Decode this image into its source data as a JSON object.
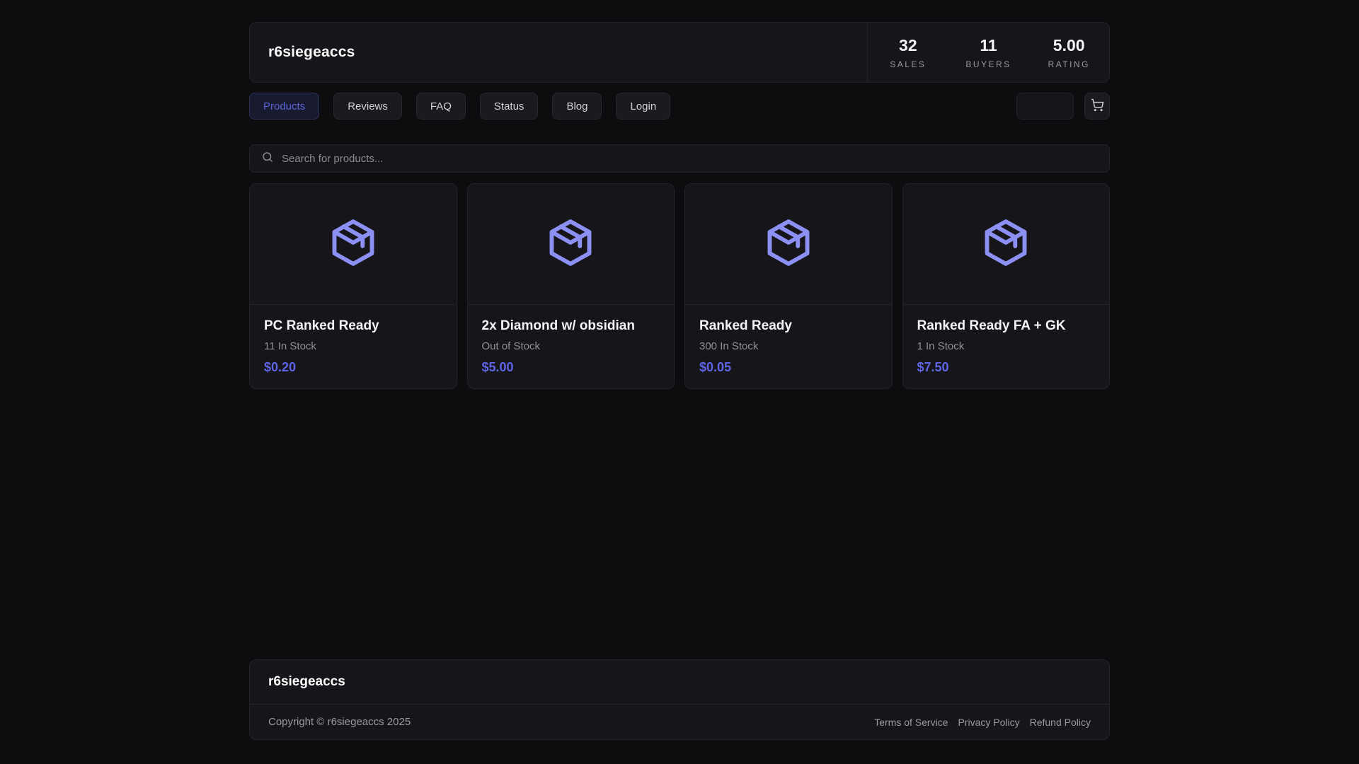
{
  "header": {
    "title": "r6siegeaccs",
    "stats": [
      {
        "value": "32",
        "label": "SALES"
      },
      {
        "value": "11",
        "label": "BUYERS"
      },
      {
        "value": "5.00",
        "label": "RATING"
      }
    ]
  },
  "nav": {
    "items": [
      {
        "label": "Products",
        "active": true
      },
      {
        "label": "Reviews",
        "active": false
      },
      {
        "label": "FAQ",
        "active": false
      },
      {
        "label": "Status",
        "active": false
      },
      {
        "label": "Blog",
        "active": false
      },
      {
        "label": "Login",
        "active": false
      }
    ]
  },
  "search": {
    "placeholder": "Search for products..."
  },
  "products": [
    {
      "name": "PC Ranked Ready",
      "stock": "11 In Stock",
      "price": "$0.20"
    },
    {
      "name": "2x Diamond w/ obsidian",
      "stock": "Out of Stock",
      "price": "$5.00"
    },
    {
      "name": "Ranked Ready",
      "stock": "300 In Stock",
      "price": "$0.05"
    },
    {
      "name": "Ranked Ready FA + GK",
      "stock": "1 In Stock",
      "price": "$7.50"
    }
  ],
  "footer": {
    "title": "r6siegeaccs",
    "copyright": "Copyright © r6siegeaccs 2025",
    "links": [
      "Terms of Service",
      "Privacy Policy",
      "Refund Policy"
    ]
  },
  "colors": {
    "accent": "#5f64e6",
    "package_icon": "#8c90f3",
    "card_background": "#16161a",
    "page_background": "#0d0d0f"
  }
}
